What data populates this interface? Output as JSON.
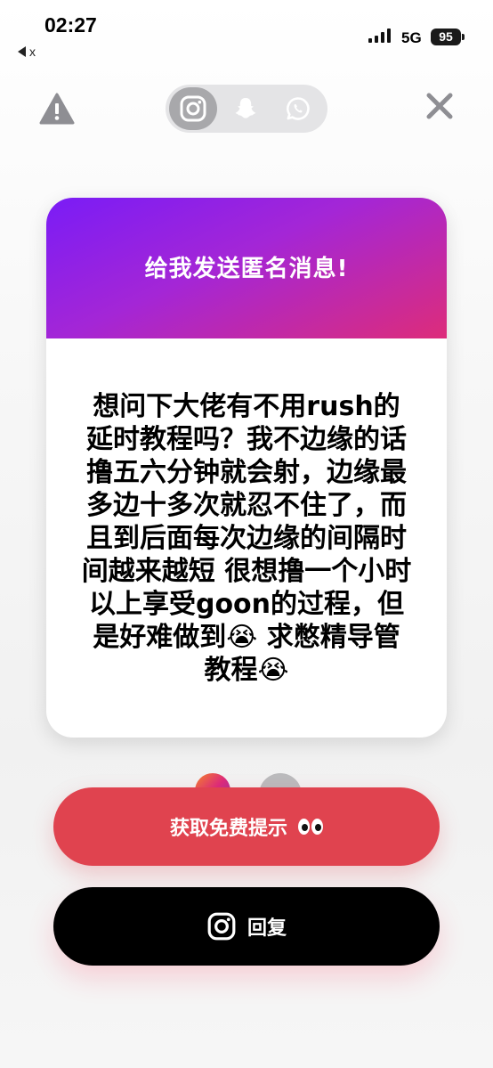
{
  "status_bar": {
    "time": "02:27",
    "back_app": "x",
    "network": "5G",
    "battery": "95"
  },
  "switcher": {
    "tabs": [
      "instagram-icon",
      "snapchat-icon",
      "whatsapp-icon"
    ],
    "active": "instagram-icon"
  },
  "card": {
    "title": "给我发送匿名消息!",
    "message": "想问下大佬有不用rush的延时教程吗？我不边缘的话撸五六分钟就会射，边缘最多边十多次就忍不住了，而且到后面每次边缘的间隔时间越来越短 很想撸一个小时以上享受goon的过程，但是好难做到😭 求憋精导管教程😭",
    "header_gradient": [
      "#7a1cf6",
      "#dd2c7a"
    ]
  },
  "buttons": {
    "hint_label": "获取免费提示",
    "reply_label": "回复"
  },
  "colors": {
    "hint_button": "#e0434f",
    "reply_button": "#000000"
  }
}
